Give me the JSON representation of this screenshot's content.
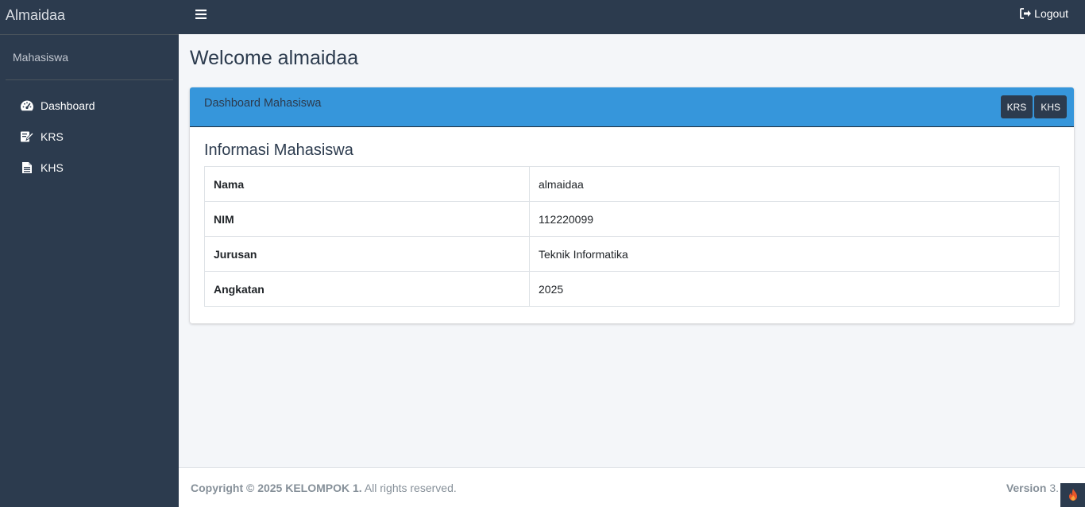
{
  "app": {
    "brand": "Almaidaa"
  },
  "sidebar": {
    "user_role": "Mahasiswa",
    "items": [
      {
        "label": "Dashboard",
        "icon": "tachometer-icon"
      },
      {
        "label": "KRS",
        "icon": "edit-icon"
      },
      {
        "label": "KHS",
        "icon": "file-text-icon"
      }
    ]
  },
  "topbar": {
    "logout_label": "Logout"
  },
  "page": {
    "title": "Welcome almaidaa"
  },
  "card": {
    "header_title": "Dashboard Mahasiswa",
    "tools": [
      "KRS",
      "KHS"
    ],
    "section_title": "Informasi Mahasiswa",
    "rows": [
      {
        "label": "Nama",
        "value": "almaidaa"
      },
      {
        "label": "NIM",
        "value": "112220099"
      },
      {
        "label": "Jurusan",
        "value": "Teknik Informatika"
      },
      {
        "label": "Angkatan",
        "value": "2025"
      }
    ]
  },
  "footer": {
    "copyright_bold": "Copyright © 2025 KELOMPOK 1.",
    "copyright_rest": "All rights reserved.",
    "version_label": "Version",
    "version_value": "3."
  },
  "colors": {
    "sidebar_bg": "#2c3b4e",
    "card_header_bg": "#3696db",
    "content_bg": "#f4f6f9"
  }
}
